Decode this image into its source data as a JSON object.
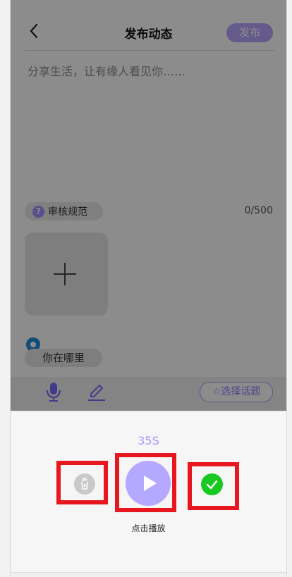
{
  "header": {
    "title": "发布动态",
    "publish_label": "发布"
  },
  "composer": {
    "placeholder": "分享生活，让有缘人看见你……",
    "review_label": "审核规范",
    "char_count": "0/500",
    "location_label": "你在哪里"
  },
  "toolbar": {
    "topic_label": "☆选择话题"
  },
  "recorder": {
    "duration": "35S",
    "play_hint": "点击播放"
  },
  "colors": {
    "accent": "#a997ff",
    "confirm": "#18c922",
    "highlight": "#e8161e"
  }
}
